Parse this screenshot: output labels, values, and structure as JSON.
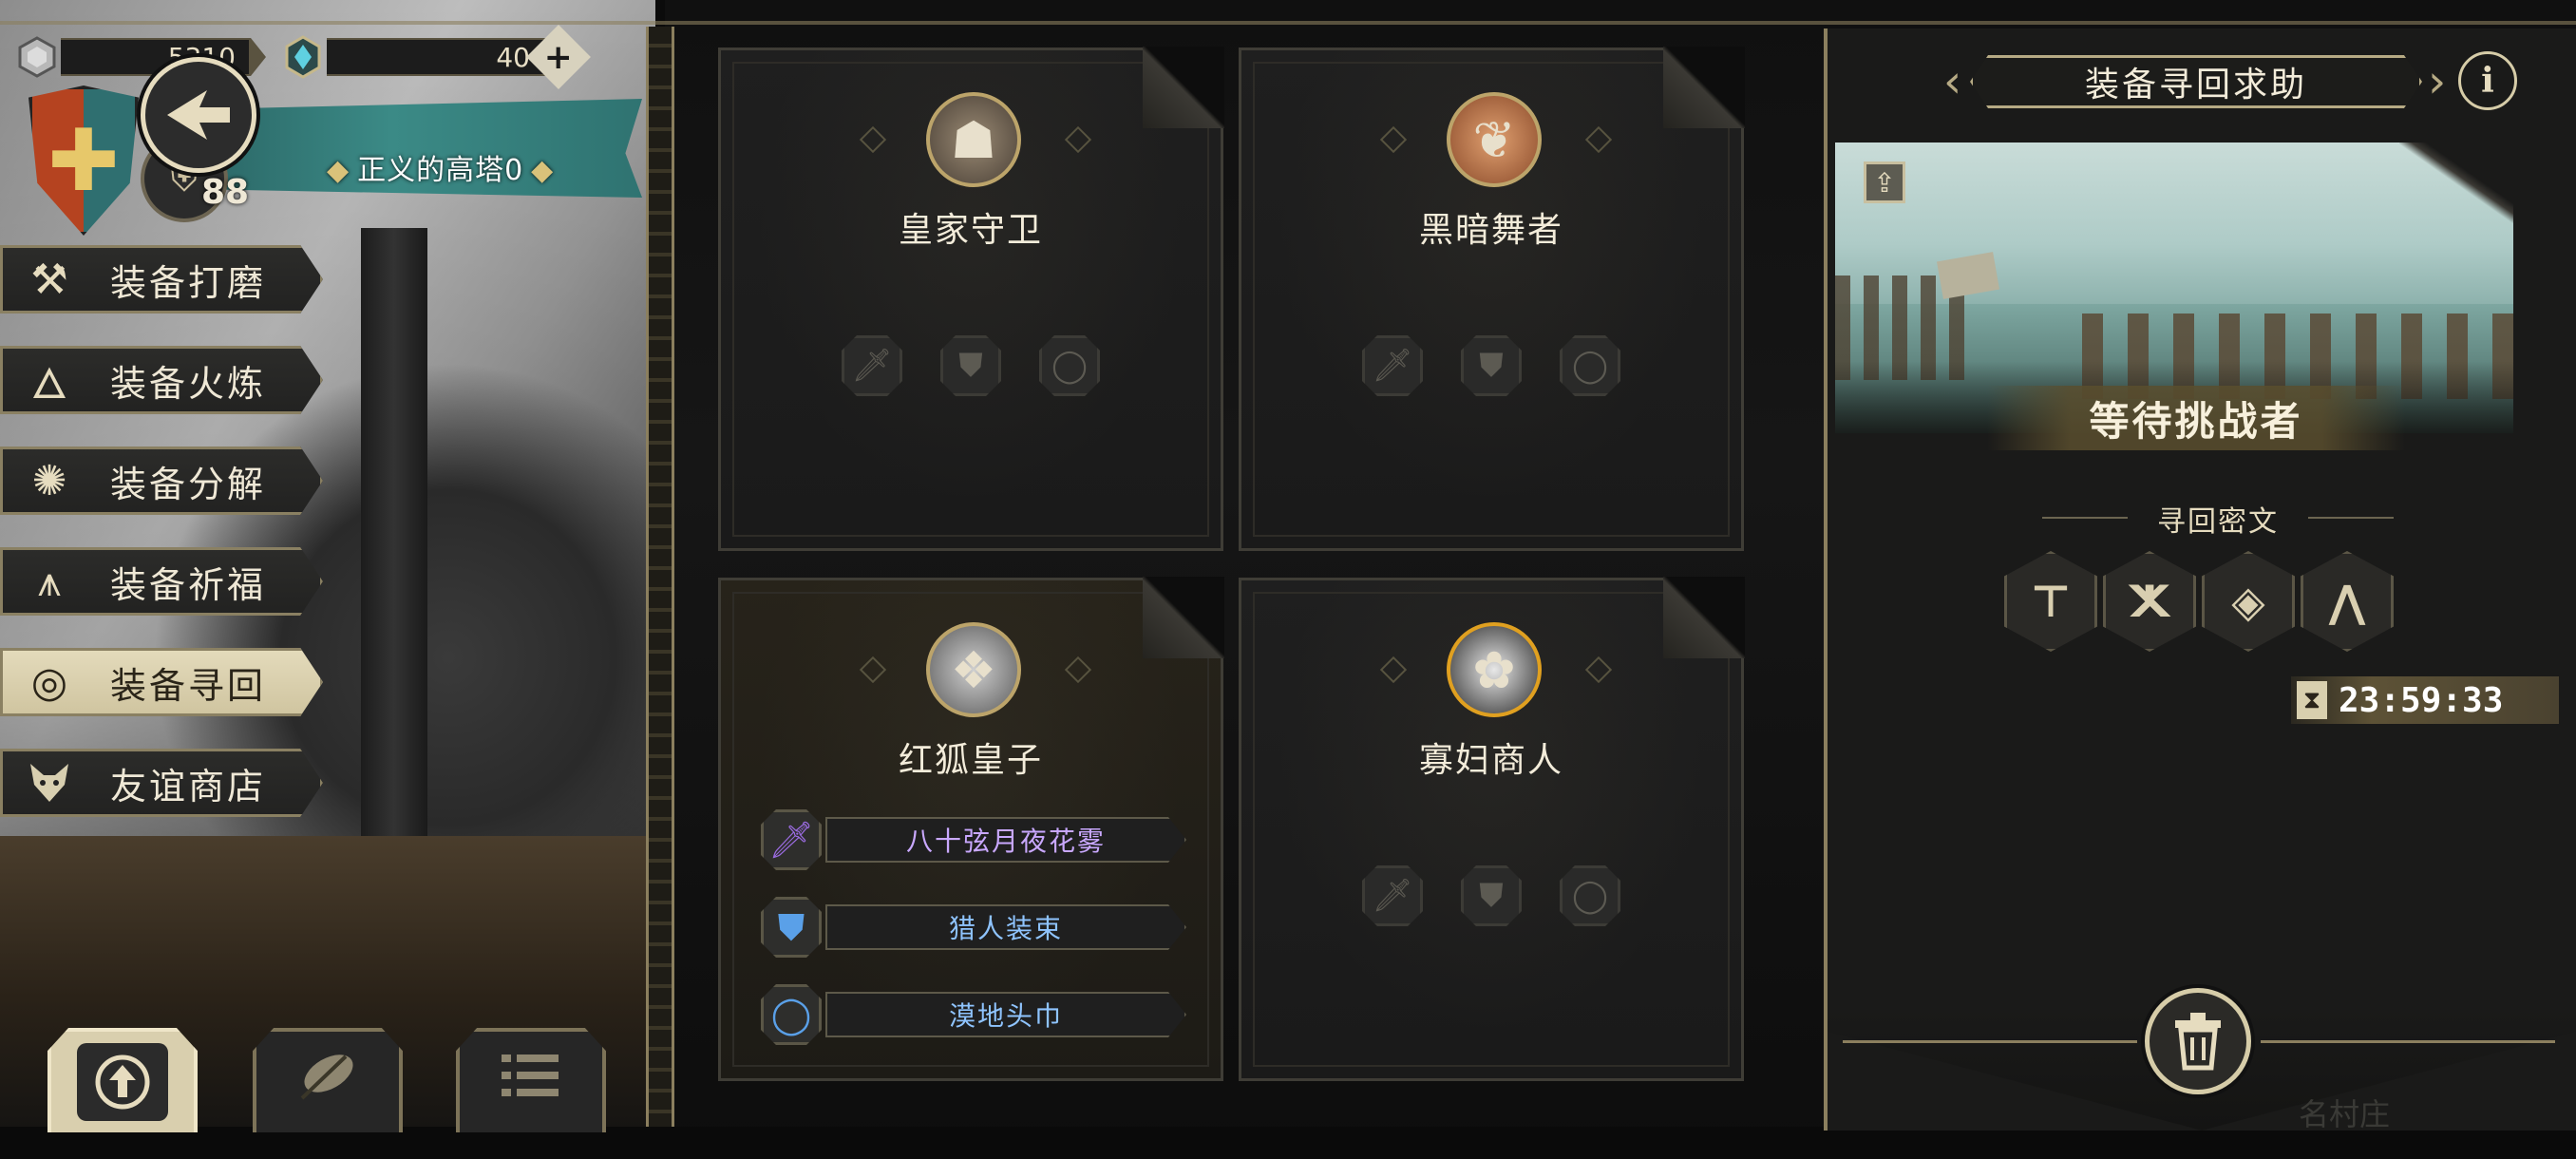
{
  "currency": {
    "silver": {
      "icon": "silver-coin-icon",
      "value": "5310"
    },
    "gem": {
      "icon": "blue-gem-icon",
      "value": "40"
    },
    "add_icon": "plus-icon"
  },
  "header": {
    "back_icon": "back-arrow-icon",
    "level": "88",
    "tower_title": "正义的高塔0"
  },
  "menu": [
    {
      "label": "装备打磨",
      "icon": "hammer-icon",
      "active": false
    },
    {
      "label": "装备火炼",
      "icon": "flame-icon",
      "active": false
    },
    {
      "label": "装备分解",
      "icon": "disassemble-icon",
      "active": false
    },
    {
      "label": "装备祈福",
      "icon": "pray-hands-icon",
      "active": false
    },
    {
      "label": "装备寻回",
      "icon": "target-icon",
      "active": true
    },
    {
      "label": "友谊商店",
      "icon": "fox-icon",
      "active": false
    }
  ],
  "bottom_tabs": [
    {
      "icon": "upload-icon",
      "active": true
    },
    {
      "icon": "feather-icon",
      "active": false
    },
    {
      "icon": "list-icon",
      "active": false
    }
  ],
  "cards": [
    {
      "name": "皇家守卫",
      "portrait": "armored-knight-portrait",
      "slots": [
        "sword-slot-icon",
        "armor-slot-icon",
        "ring-slot-icon"
      ]
    },
    {
      "name": "黑暗舞者",
      "portrait": "rat-dancer-portrait",
      "slots": [
        "sword-slot-icon",
        "armor-slot-icon",
        "ring-slot-icon"
      ]
    },
    {
      "name": "红狐皇子",
      "portrait": "wolf-prince-portrait",
      "equipment": [
        {
          "name": "八十弦月夜花雾",
          "icon": "purple-sword-icon",
          "color": "#c9a8ff"
        },
        {
          "name": "猎人装束",
          "icon": "blue-armor-icon",
          "color": "#8fc4ff"
        },
        {
          "name": "漠地头巾",
          "icon": "blue-ring-icon",
          "color": "#8fc4ff"
        }
      ]
    },
    {
      "name": "寡妇商人",
      "portrait": "widow-merchant-portrait",
      "slots": [
        "sword-slot-icon",
        "armor-slot-icon",
        "ring-slot-icon"
      ]
    }
  ],
  "panel": {
    "title": "装备寻回求助",
    "info_icon": "info-icon",
    "status": "等待挑战者",
    "cipher_label": "寻回密文",
    "runes": [
      "rune-1-icon",
      "rune-2-icon",
      "rune-3-icon",
      "rune-4-icon"
    ],
    "timer": "23:59:33",
    "timer_icon": "hourglass-icon",
    "trash_icon": "trash-icon",
    "upload_icon": "upload-icon",
    "ghost_text": "名村庄"
  }
}
